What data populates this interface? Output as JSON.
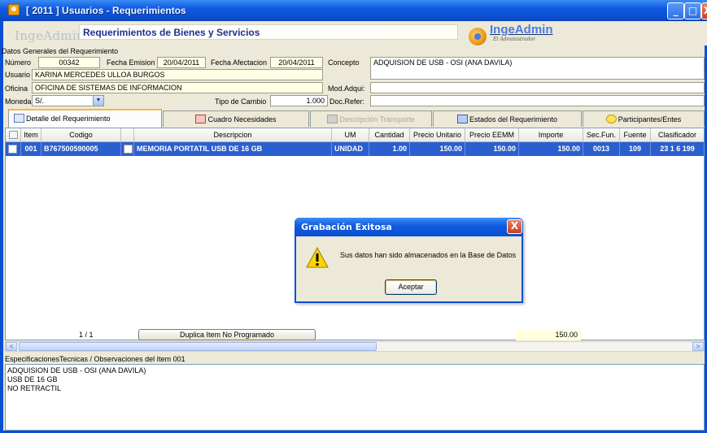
{
  "window": {
    "title": "[ 2011 ] Usuarios - Requerimientos",
    "min_glyph": "_",
    "max_glyph": "□",
    "close_glyph": "X"
  },
  "header": {
    "brand_left": "IngeAdmin",
    "module_title": "Requerimientos de Bienes y Servicios",
    "brand_right_a": "Inge",
    "brand_right_b": "Admin",
    "brand_tagline": "El Administrador"
  },
  "general": {
    "section_title": "Datos Generales del Requerimiento",
    "numero_label": "Número",
    "numero_value": "00342",
    "fecha_emision_label": "Fecha Emision",
    "fecha_emision_value": "20/04/2011",
    "fecha_afectacion_label": "Fecha Afectacion",
    "fecha_afectacion_value": "20/04/2011",
    "concepto_label": "Concepto",
    "concepto_value": "ADQUISION DE USB - OSI (ANA DAVILA)",
    "usuario_label": "Usuario",
    "usuario_value": "KARINA MERCEDES ULLOA BURGOS",
    "oficina_label": "Oficina",
    "oficina_value": "OFICINA DE SISTEMAS DE INFORMACION",
    "mod_adqui_label": "Mod.Adqui:",
    "mod_adqui_value": "",
    "moneda_label": "Moneda",
    "moneda_value": "S/.",
    "tipo_cambio_label": "Tipo de Cambio",
    "tipo_cambio_value": "1.000",
    "doc_refer_label": "Doc.Refer:",
    "doc_refer_value": ""
  },
  "tabs": [
    {
      "label": "Detalle del Requerimiento",
      "icon": "grid-icon"
    },
    {
      "label": "Cuadro Necesidades",
      "icon": "chart-icon"
    },
    {
      "label": "Descripción Transporte",
      "icon": "doc-icon"
    },
    {
      "label": "Estados del Requerimiento",
      "icon": "list-icon"
    },
    {
      "label": "Participantes/Entes",
      "icon": "smiley-icon"
    }
  ],
  "grid": {
    "columns": [
      "",
      "Item",
      "Codigo",
      "",
      "Descripcion",
      "UM",
      "Cantidad",
      "Precio Unitario",
      "Precio EEMM",
      "Importe",
      "Sec.Fun.",
      "Fuente",
      "Clasificador"
    ],
    "rows": [
      {
        "item": "001",
        "codigo": "B767500590005",
        "descripcion": "MEMORIA PORTATIL USB DE 16 GB",
        "um": "UNIDAD",
        "cantidad": "1.00",
        "precio_unitario": "150.00",
        "precio_eemm": "150.00",
        "importe": "150.00",
        "sec_fun": "0013",
        "fuente": "109",
        "clasificador": "23 1 6 199"
      }
    ]
  },
  "footer": {
    "pager": "1 / 1",
    "duplicate_button": "Duplica Item No Programado",
    "total": "150.00"
  },
  "specs": {
    "label": "EspecificacionesTecnicas / Observaciones del Item 001",
    "lines": [
      "ADQUISION DE USB - OSI (ANA DAVILA)",
      "USB DE 16 GB",
      "NO RETRACTIL"
    ]
  },
  "dialog": {
    "title": "Grabación Exitosa",
    "message": "Sus datos han sido almacenados en la Base de Datos",
    "button": "Aceptar",
    "close_glyph": "X"
  },
  "colors": {
    "title_bar": "#0f5ae0",
    "selected_row": "#2b5fd0",
    "module_title_text": "#1f2f8f"
  }
}
